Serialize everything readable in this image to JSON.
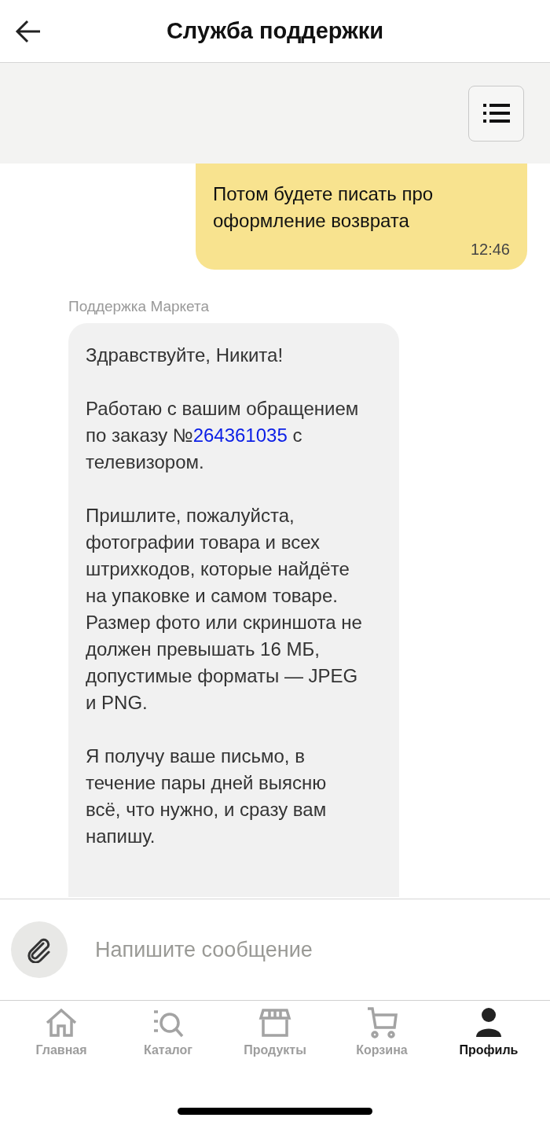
{
  "header": {
    "title": "Служба поддержки"
  },
  "messages": [
    {
      "kind": "outgoing",
      "text": "Потом будете писать про оформление возврата",
      "time": "12:46"
    },
    {
      "kind": "incoming",
      "sender": "Поддержка Маркета",
      "paragraphs": [
        {
          "text": "Здравствуйте, Никита!"
        },
        {
          "text": "Работаю с вашим обращением по заказу №",
          "link": "264361035",
          "after": " с телевизором."
        },
        {
          "text": "Пришлите, пожалуйста, фотографии товара и всех штрихкодов, которые найдёте на упаковке и самом товаре. Размер фото или скриншота не должен превышать 16 МБ, допустимые форматы — JPEG и PNG."
        },
        {
          "text": "Я получу ваше письмо, в течение пары дней выясню всё, что нужно, и сразу вам напишу."
        }
      ]
    }
  ],
  "composer": {
    "placeholder": "Напишите сообщение"
  },
  "tabs": [
    {
      "kind": "home",
      "label": "Главная",
      "selected": false
    },
    {
      "kind": "catalog",
      "label": "Каталог",
      "selected": false
    },
    {
      "kind": "store",
      "label": "Продукты",
      "selected": false
    },
    {
      "kind": "cart",
      "label": "Корзина",
      "selected": false
    },
    {
      "kind": "profile",
      "label": "Профиль",
      "selected": true
    }
  ]
}
